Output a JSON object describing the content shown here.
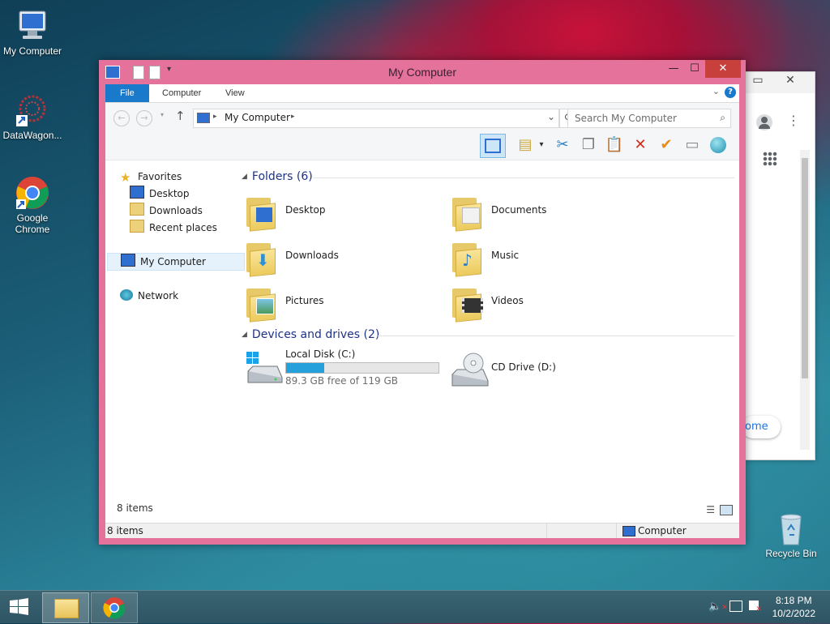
{
  "desktop": {
    "icons": [
      {
        "label": "My Computer"
      },
      {
        "label": "DataWagon..."
      },
      {
        "label": "Google Chrome"
      },
      {
        "label": "Recycle Bin"
      }
    ]
  },
  "background_window": {
    "partial_text": "ome",
    "close_glyph": "✕",
    "min_glyph": "▭"
  },
  "window": {
    "title": "My Computer",
    "controls": {
      "minimize": "—",
      "maximize": "☐",
      "close": "✕"
    },
    "ribbon_tabs": {
      "file": "File",
      "computer": "Computer",
      "view": "View"
    },
    "address": {
      "crumb": "My Computer",
      "arrow": "▸"
    },
    "search": {
      "placeholder": "Search My Computer"
    },
    "nav": {
      "favorites": "Favorites",
      "desktop": "Desktop",
      "downloads": "Downloads",
      "recent": "Recent places",
      "my_computer": "My Computer",
      "network": "Network"
    },
    "folders": {
      "header": "Folders (6)",
      "items": [
        "Desktop",
        "Documents",
        "Downloads",
        "Music",
        "Pictures",
        "Videos"
      ]
    },
    "drives": {
      "header": "Devices and drives (2)",
      "local_disk": {
        "name": "Local Disk (C:)",
        "free": "89.3 GB free of 119 GB",
        "used_fraction": 0.25
      },
      "cd_drive": {
        "name": "CD Drive (D:)"
      }
    },
    "items_count": "8 items",
    "status": {
      "left": "8 items",
      "right": "Computer"
    }
  },
  "taskbar": {
    "time": "8:18 PM",
    "date": "10/2/2022"
  },
  "colors": {
    "window_frame": "#e5729b",
    "accent_blue": "#1979ca",
    "disk_bar": "#26a0da"
  }
}
